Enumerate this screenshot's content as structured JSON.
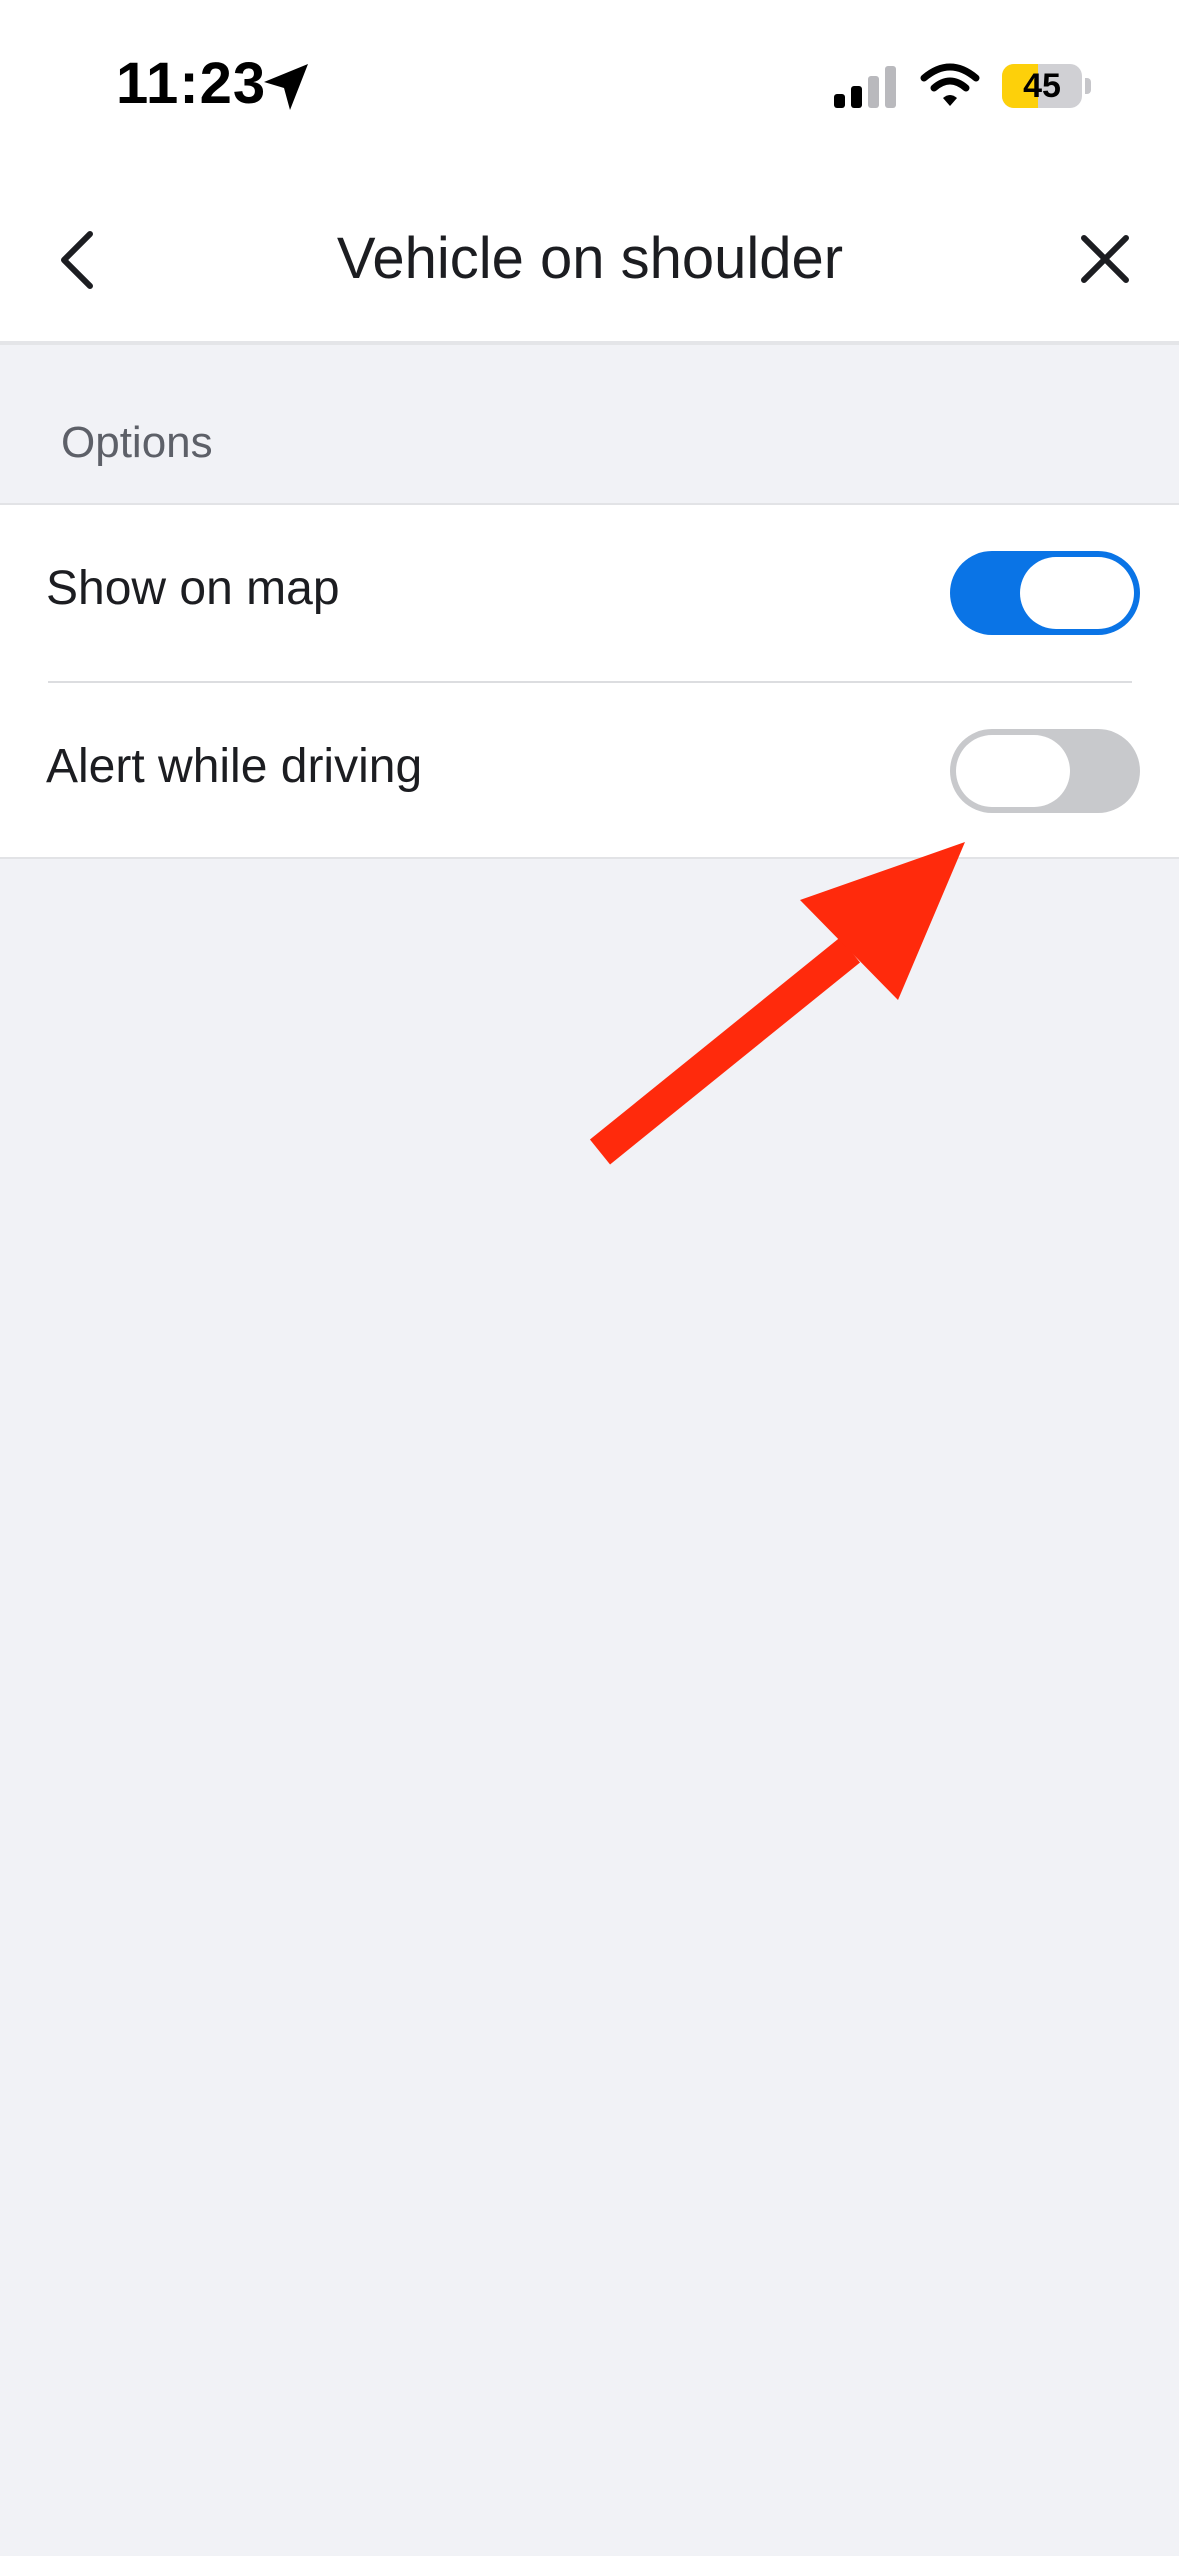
{
  "status_bar": {
    "time": "11:23",
    "battery_level": "45",
    "battery_fraction": 0.45,
    "icons": [
      "location-arrow-icon",
      "cellular-signal-icon",
      "wifi-icon",
      "battery-icon"
    ]
  },
  "nav": {
    "title": "Vehicle on shoulder",
    "back_icon": "chevron-left-icon",
    "close_icon": "close-icon"
  },
  "section": {
    "label": "Options"
  },
  "options": [
    {
      "label": "Show on map",
      "enabled": true
    },
    {
      "label": "Alert while driving",
      "enabled": false
    }
  ],
  "colors": {
    "toggle_on": "#0a74e6",
    "toggle_off": "#c8c9cc",
    "annotation_arrow": "#ff2a0c",
    "background": "#f1f2f6"
  }
}
